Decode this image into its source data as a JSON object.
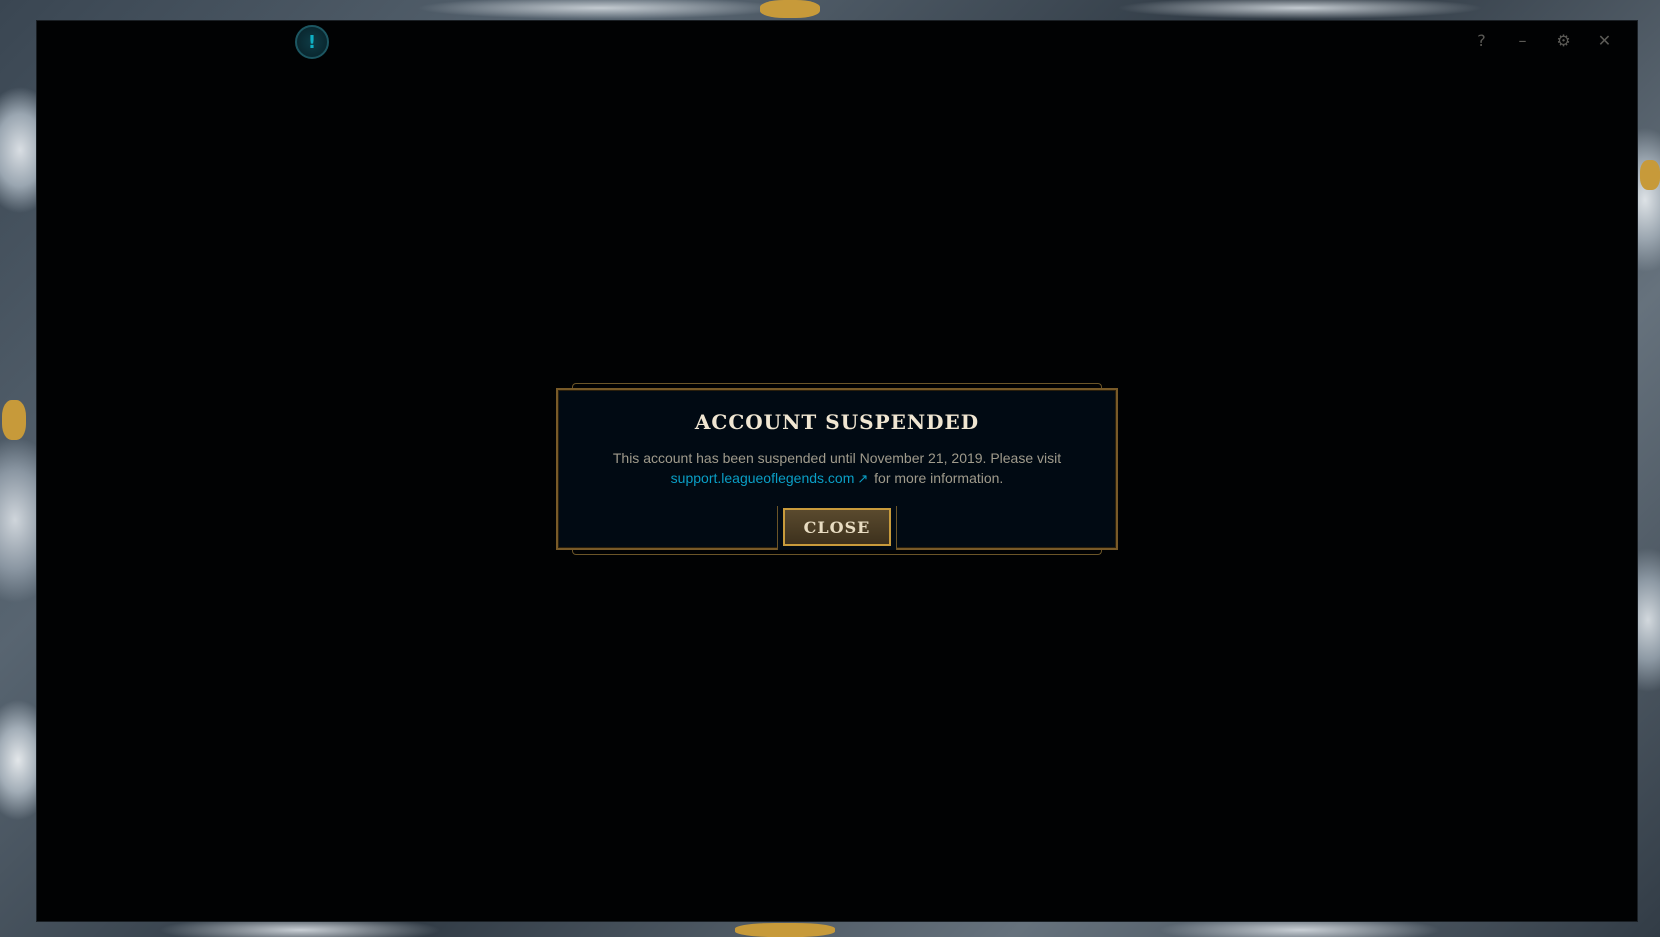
{
  "titlebar": {
    "alert_icon_glyph": "!",
    "help_glyph": "?",
    "minimize_glyph": "–",
    "settings_glyph": "⚙",
    "close_glyph": "✕"
  },
  "dialog": {
    "title": "ACCOUNT SUSPENDED",
    "message_before_link": "This account has been suspended until November 21, 2019. Please visit",
    "link_text": "support.leagueoflegends.com",
    "external_link_icon": "external-link-icon",
    "message_after_link": "for more information.",
    "close_button_label": "CLOSE"
  },
  "colors": {
    "dialog_background": "#010a13",
    "gold_border": "#785a28",
    "title_text": "#f0e6d2",
    "body_text": "#a09b8c",
    "link": "#0a9fc6"
  }
}
